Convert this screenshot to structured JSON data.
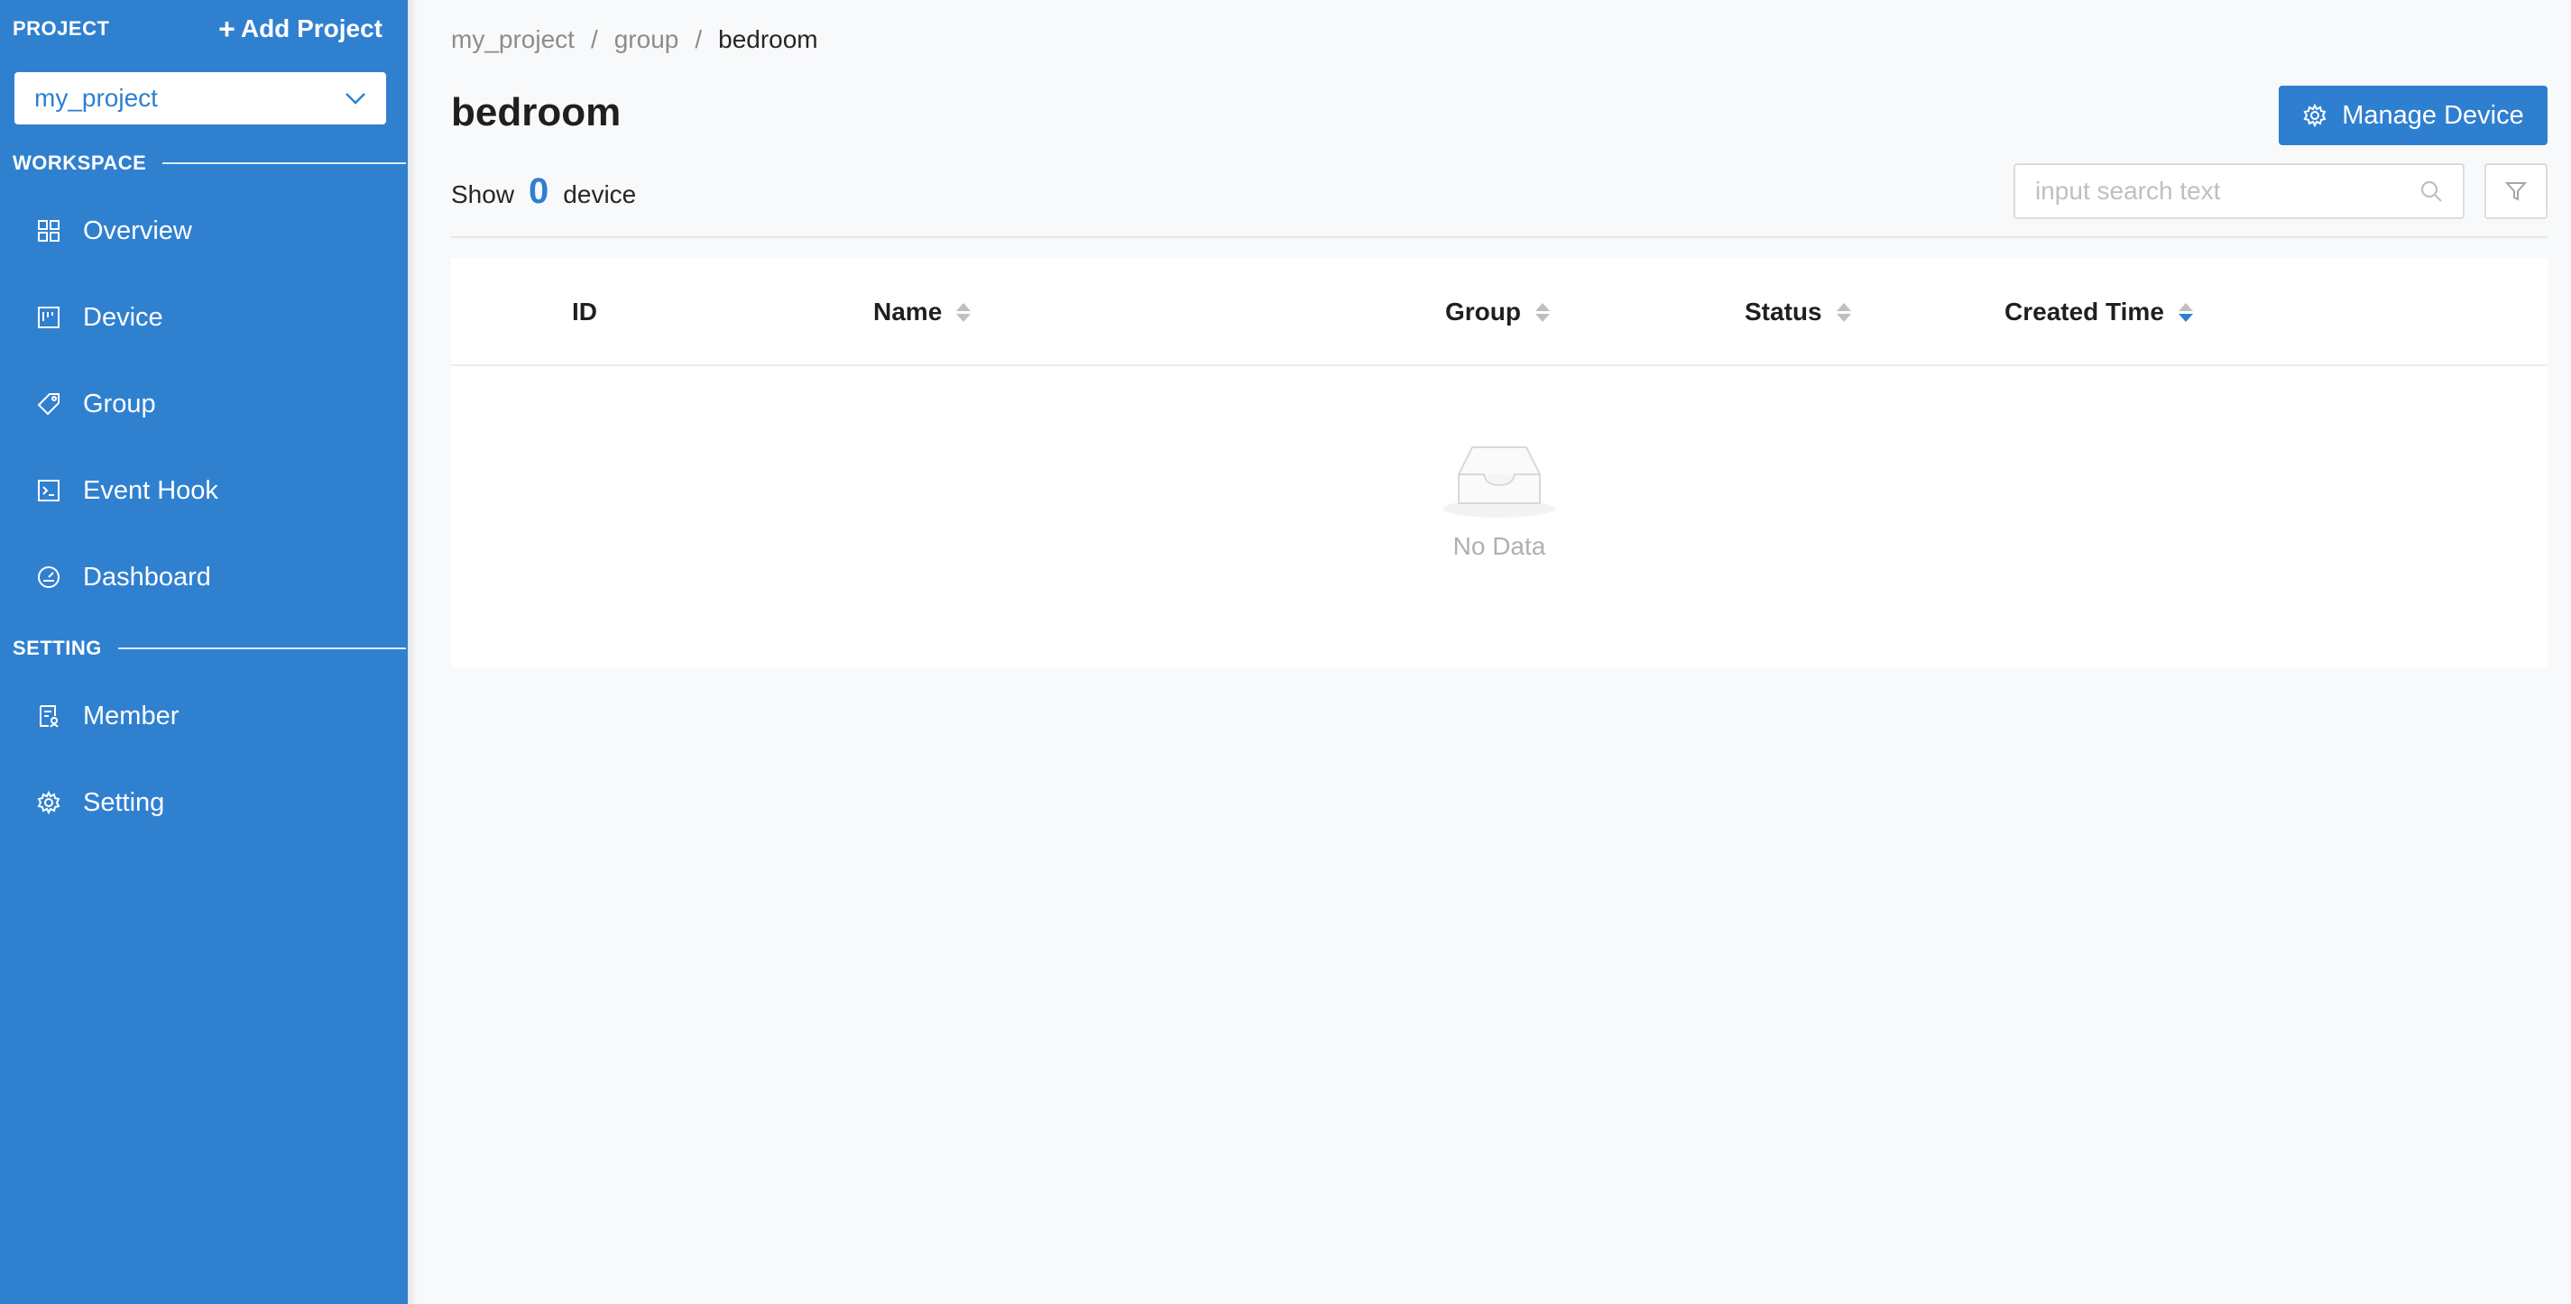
{
  "sidebar": {
    "project_label": "PROJECT",
    "add_project_label": "Add Project",
    "selected_project": "my_project",
    "workspace_label": "WORKSPACE",
    "setting_label": "SETTING",
    "workspace_items": [
      {
        "label": "Overview",
        "icon": "grid-icon"
      },
      {
        "label": "Device",
        "icon": "device-icon"
      },
      {
        "label": "Group",
        "icon": "tag-icon"
      },
      {
        "label": "Event Hook",
        "icon": "terminal-icon"
      },
      {
        "label": "Dashboard",
        "icon": "gauge-icon"
      }
    ],
    "setting_items": [
      {
        "label": "Member",
        "icon": "member-icon"
      },
      {
        "label": "Setting",
        "icon": "gear-icon"
      }
    ]
  },
  "breadcrumb": {
    "items": [
      "my_project",
      "group",
      "bedroom"
    ],
    "separator": "/"
  },
  "page": {
    "title": "bedroom",
    "manage_button_label": "Manage Device",
    "show_label": "Show",
    "device_count": "0",
    "device_label": "device"
  },
  "search": {
    "placeholder": "input search text",
    "value": ""
  },
  "table": {
    "columns": [
      {
        "label": "ID",
        "sortable": false
      },
      {
        "label": "Name",
        "sortable": true
      },
      {
        "label": "Group",
        "sortable": true
      },
      {
        "label": "Status",
        "sortable": true
      },
      {
        "label": "Created Time",
        "sortable": true,
        "sort": "descend"
      }
    ],
    "rows": [],
    "empty_text": "No Data"
  },
  "colors": {
    "brand": "#3080d0",
    "accent": "#2f7fd0",
    "background": "#f8f9fb"
  }
}
